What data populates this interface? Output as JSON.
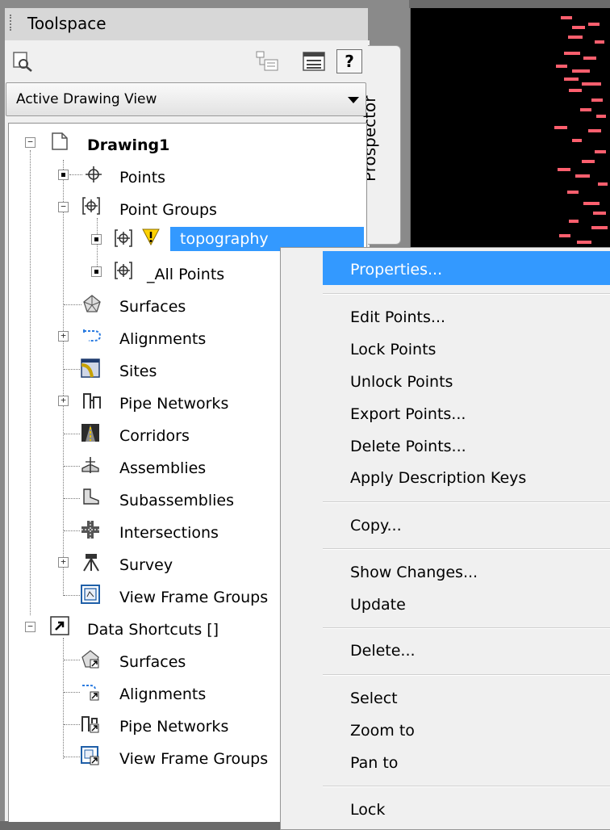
{
  "toolspace": {
    "title": "Toolspace",
    "view_dropdown": "Active Drawing View",
    "side_tab": "Prospector",
    "help_button": "?"
  },
  "tree": {
    "drawing": "Drawing1",
    "points": "Points",
    "point_groups": "Point Groups",
    "topography": "topography",
    "all_points": "_All Points",
    "surfaces": "Surfaces",
    "alignments": "Alignments",
    "sites": "Sites",
    "pipe_networks": "Pipe Networks",
    "corridors": "Corridors",
    "assemblies": "Assemblies",
    "subassemblies": "Subassemblies",
    "intersections": "Intersections",
    "survey": "Survey",
    "view_frame_groups": "View Frame Groups",
    "data_shortcuts": "Data Shortcuts []",
    "ds_surfaces": "Surfaces",
    "ds_alignments": "Alignments",
    "ds_pipe_networks": "Pipe Networks",
    "ds_view_frame_groups": "View Frame Groups"
  },
  "context_menu": {
    "properties": "Properties...",
    "edit_points": "Edit Points...",
    "lock_points": "Lock Points",
    "unlock_points": "Unlock Points",
    "export_points": "Export Points...",
    "delete_points": "Delete Points...",
    "apply_description_keys": "Apply Description Keys",
    "copy": "Copy...",
    "show_changes": "Show Changes...",
    "update": "Update",
    "delete": "Delete...",
    "select": "Select",
    "zoom_to": "Zoom to",
    "pan_to": "Pan to",
    "lock": "Lock"
  },
  "colors": {
    "selection": "#3399ff",
    "point_marker": "#ff5f6e",
    "canvas": "#000000",
    "warning_icon": "#ffd200"
  },
  "icons": [
    "drawing-icon",
    "point-icon",
    "point-group-icon",
    "warning-icon",
    "surface-icon",
    "alignment-icon",
    "site-icon",
    "pipe-network-icon",
    "corridor-icon",
    "assembly-icon",
    "subassembly-icon",
    "intersection-icon",
    "survey-icon",
    "view-frame-group-icon",
    "data-shortcut-icon"
  ]
}
